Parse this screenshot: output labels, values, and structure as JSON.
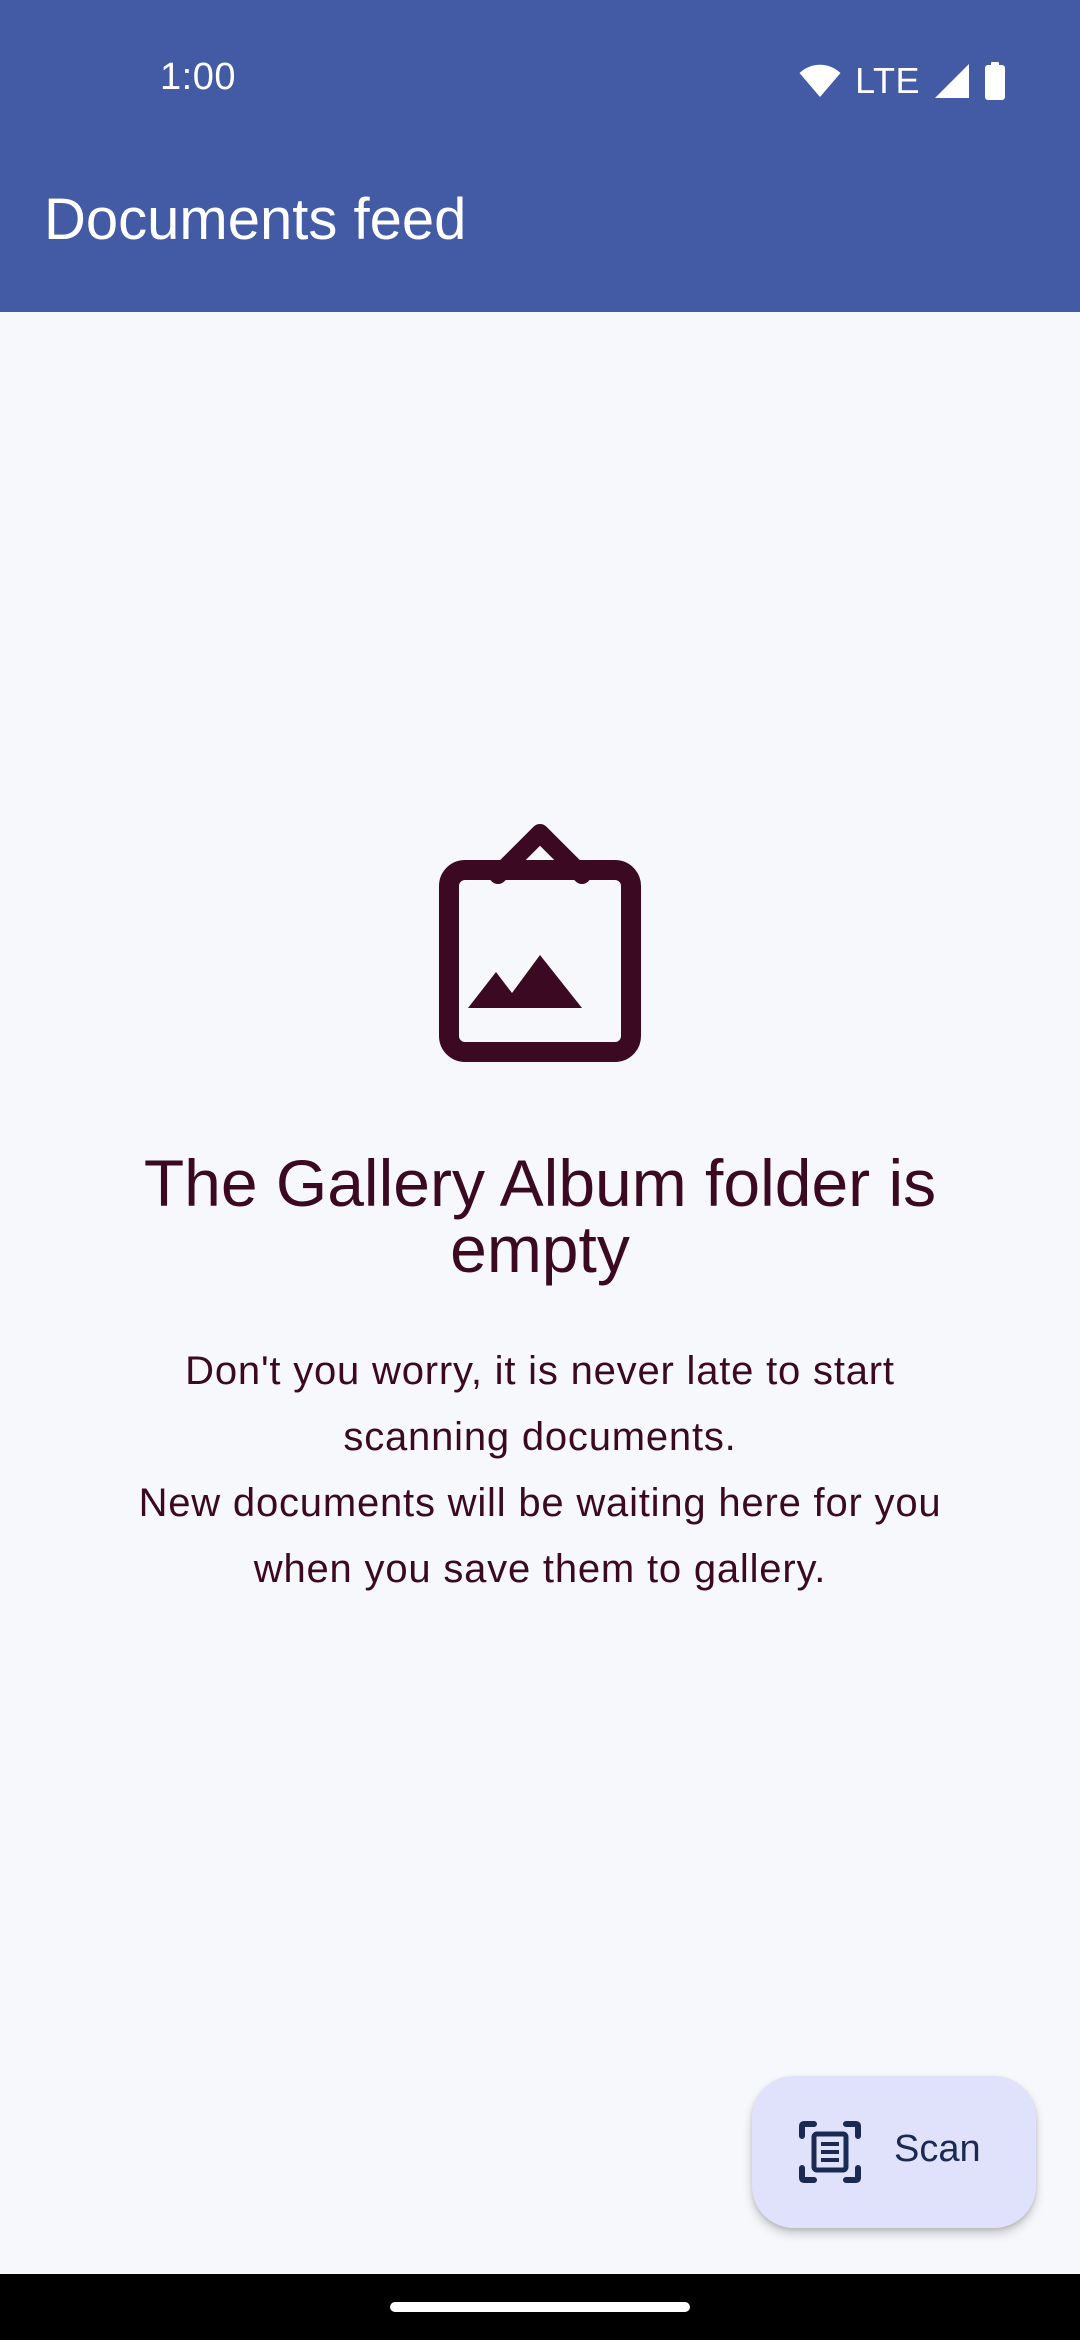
{
  "status_bar": {
    "time": "1:00",
    "network": "LTE",
    "icons": [
      "wifi-icon",
      "cell-signal-icon",
      "battery-icon"
    ]
  },
  "toolbar": {
    "title": "Documents feed"
  },
  "empty_state": {
    "icon": "gallery-album-icon",
    "title": "The Gallery Album folder is empty",
    "description_lines": [
      "Don't you worry, it is never late to start",
      "scanning documents.",
      "New documents will be waiting here for you",
      "when you save them to gallery."
    ]
  },
  "fab": {
    "icon": "document-scan-icon",
    "label": "Scan"
  },
  "colors": {
    "app_bar": "#435BA4",
    "background": "#F7F8FB",
    "on_surface": "#3B0A22",
    "fab_container": "#DFE2FA",
    "fab_content": "#1B2A52"
  }
}
